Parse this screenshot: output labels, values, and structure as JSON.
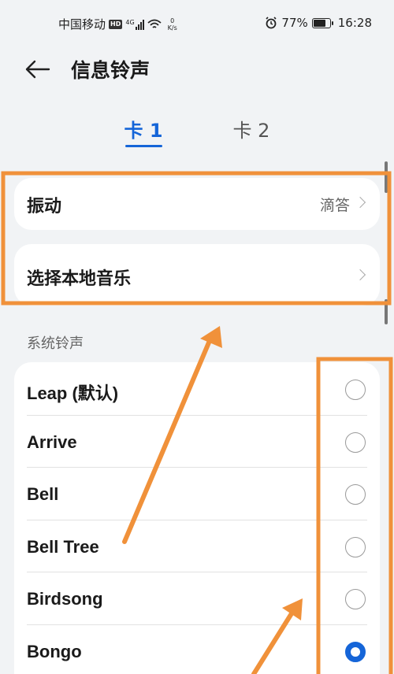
{
  "status_bar": {
    "carrier": "中国移动",
    "hd": "HD",
    "network": "4G",
    "net_speed_value": "0",
    "net_speed_unit": "K/s",
    "battery": "77%",
    "battery_level": 0.77,
    "time": "16:28"
  },
  "header": {
    "title": "信息铃声"
  },
  "tabs": [
    {
      "label": "卡 1",
      "selected": true
    },
    {
      "label": "卡 2",
      "selected": false
    }
  ],
  "settings": {
    "vibration_label": "振动",
    "vibration_value": "滴答",
    "local_music_label": "选择本地音乐"
  },
  "section": {
    "title": "系统铃声"
  },
  "ringtones": [
    {
      "name": "Leap (默认)",
      "selected": false
    },
    {
      "name": "Arrive",
      "selected": false
    },
    {
      "name": "Bell",
      "selected": false
    },
    {
      "name": "Bell Tree",
      "selected": false
    },
    {
      "name": "Birdsong",
      "selected": false
    },
    {
      "name": "Bongo",
      "selected": true
    }
  ],
  "colors": {
    "accent": "#1565d8",
    "annotation": "#f0913a",
    "background": "#f1f3f5"
  }
}
